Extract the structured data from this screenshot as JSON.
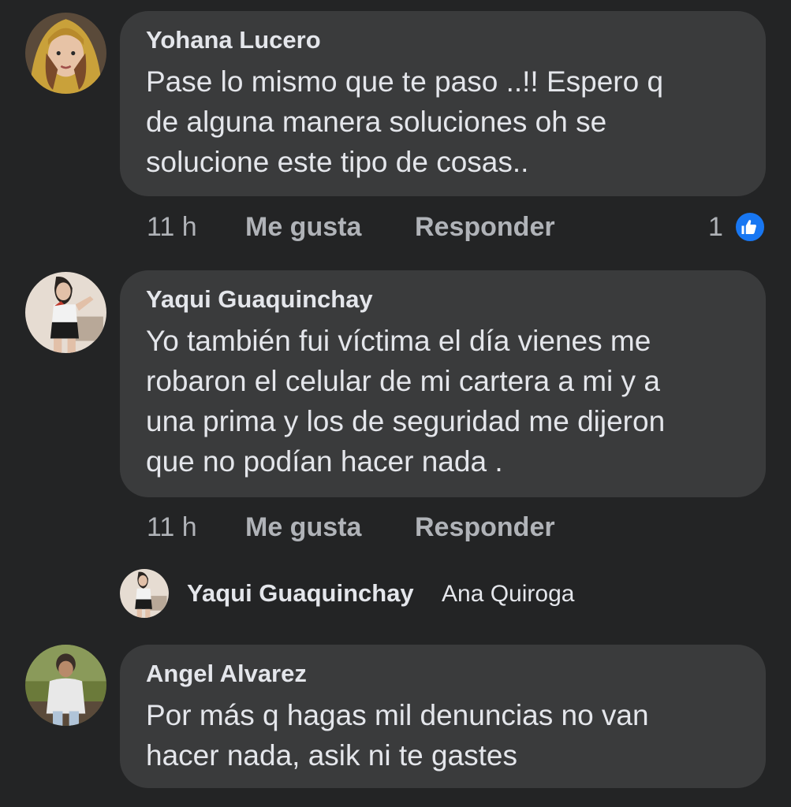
{
  "comments": [
    {
      "author": "Yohana Lucero",
      "lines": [
        "Pase lo mismo que te paso ..!! Espero q",
        "de alguna manera soluciones oh se",
        "solucione este tipo de cosas.."
      ],
      "time": "11 h",
      "like_label": "Me gusta",
      "reply_label": "Responder",
      "reaction_count": "1"
    },
    {
      "author": "Yaqui Guaquinchay",
      "lines": [
        "Yo también fui víctima el día  vienes me",
        "robaron el celular de mi cartera a mi y a",
        "una prima y los de seguridad me dijeron",
        "que no podían hacer nada ."
      ],
      "time": "11 h",
      "like_label": "Me gusta",
      "reply_label": "Responder"
    },
    {
      "author": "Angel Alvarez",
      "lines": [
        "Por más q hagas mil denuncias no van",
        "hacer nada, asik ni te gastes"
      ]
    }
  ],
  "reply_preview": {
    "author": "Yaqui Guaquinchay",
    "mention": "Ana Quiroga"
  },
  "colors": {
    "background": "#232425",
    "bubble": "#3a3b3c",
    "text": "#e4e6eb",
    "secondary_text": "#b0b3b8",
    "like_blue": "#1877f2"
  }
}
